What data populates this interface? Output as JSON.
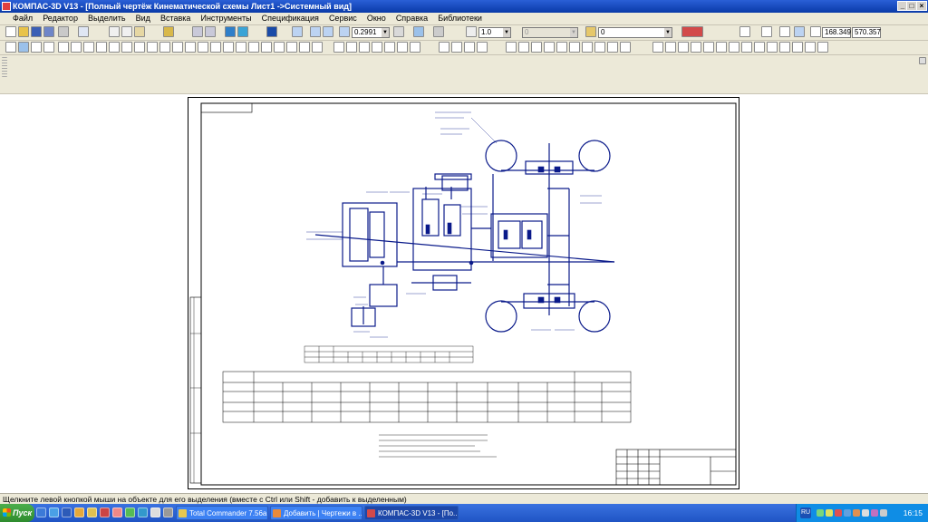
{
  "window": {
    "title": "КОМПАС-3D V13 - [Полный чертёж Кинематической схемы Лист1 ->Системный вид]"
  },
  "menu": [
    "Файл",
    "Редактор",
    "Выделить",
    "Вид",
    "Вставка",
    "Инструменты",
    "Спецификация",
    "Сервис",
    "Окно",
    "Справка",
    "Библиотеки"
  ],
  "toolbar": {
    "zoom_value": "0.2991",
    "step_value": "1.0",
    "layer_value": "0",
    "state_value": "0",
    "coord_x": "168.349",
    "coord_y": "570.357"
  },
  "status": {
    "message": "Щелкните левой кнопкой мыши на объекте для его выделения (вместе с Ctrl или Shift - добавить к выделенным)"
  },
  "taskbar": {
    "start_label": "Пуск",
    "tasks": [
      "Total Commander 7.56a ...",
      "Добавить | Чертежи в ...",
      "КОМПАС-3D V13 - [По..."
    ],
    "lang": "RU",
    "clock": "16:15"
  },
  "colors": {
    "title_bar": "#0a3aa8",
    "drawing_line": "#0a1a8a",
    "window_chrome": "#ece9d8",
    "taskbar": "#1f54c4"
  },
  "icons": {
    "app": "kompas-app-icon",
    "start": "windows-flag-icon"
  }
}
